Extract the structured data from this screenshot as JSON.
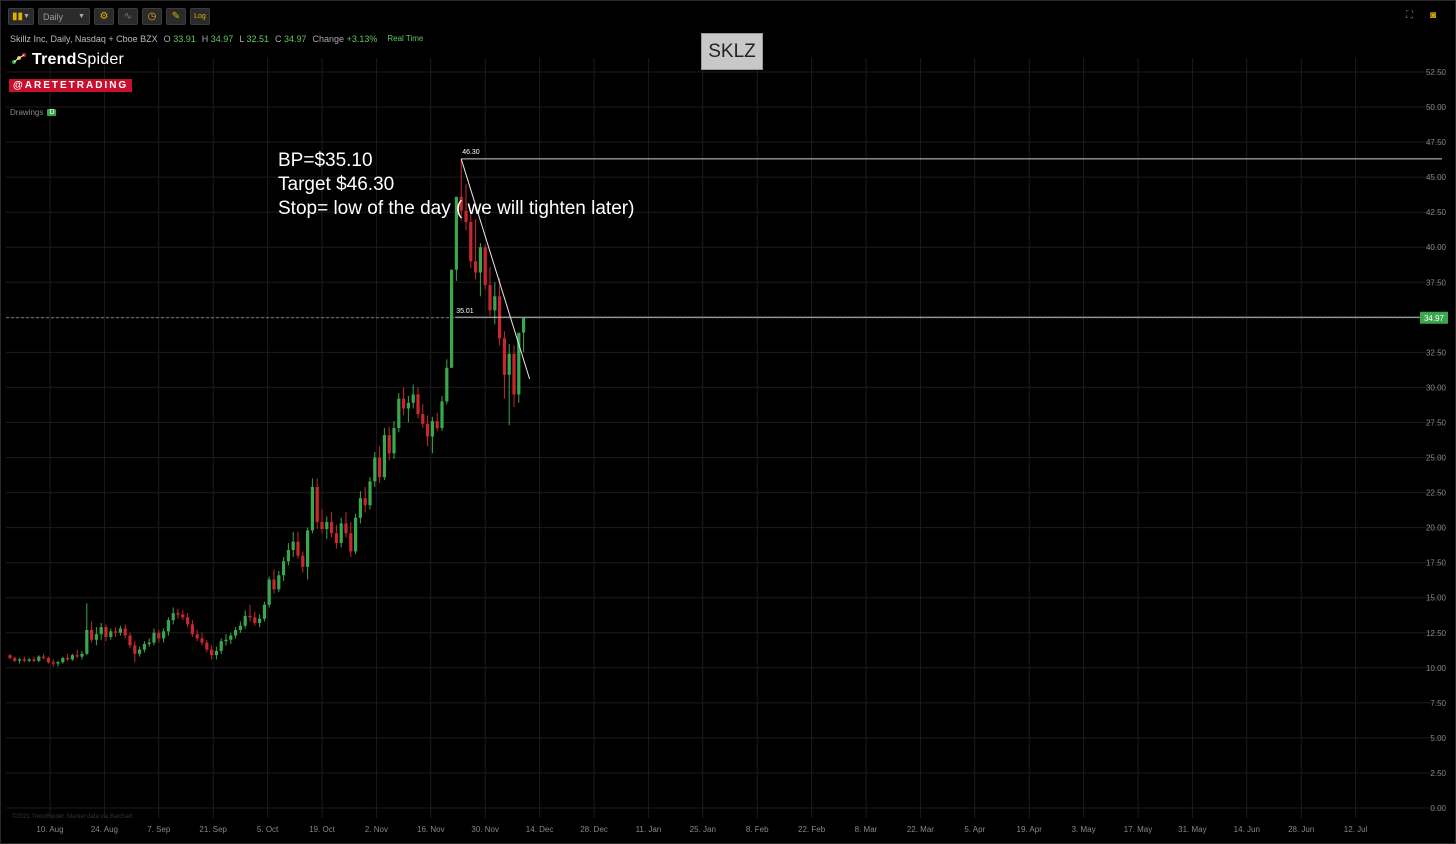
{
  "toolbar": {
    "interval": "Daily",
    "log_label": "Log"
  },
  "header": {
    "title": "Skillz Inc, Daily, Nasdaq + Cboe BZX",
    "open_label": "O",
    "open": "33.91",
    "high_label": "H",
    "high": "34.97",
    "low_label": "L",
    "low": "32.51",
    "close_label": "C",
    "close": "34.97",
    "change_label": "Change",
    "change": "+3.13%",
    "realtime": "Real Time"
  },
  "brand": {
    "name_bold": "Trend",
    "name_light": "Spider",
    "handle": "@ARETETRADING"
  },
  "drawings": {
    "label": "Drawings",
    "badge": "D"
  },
  "ticker": "SKLZ",
  "note": {
    "line1": "BP=$35.10",
    "line2": "Target $46.30",
    "line3": "Stop= low of the day ( we will tighten later)"
  },
  "watermark": "©2021 TrendSpider. Market data via Barchart",
  "colors": {
    "up": "#3aa84a",
    "down": "#c8282d",
    "grid": "#1c1c1c",
    "text": "#888888",
    "price_tag": "#3aa84a"
  },
  "chart_data": {
    "type": "candlestick",
    "title": "SKLZ",
    "y_axis": {
      "min": 0,
      "max": 52.5,
      "step": 2.5,
      "position": "right"
    },
    "y_ticks": [
      "0.00",
      "2.50",
      "5.00",
      "7.50",
      "10.00",
      "12.50",
      "15.00",
      "17.50",
      "20.00",
      "22.50",
      "25.00",
      "27.50",
      "30.00",
      "32.50",
      "35.00",
      "37.50",
      "40.00",
      "42.50",
      "45.00",
      "47.50",
      "50.00",
      "52.50"
    ],
    "x_ticks": [
      "10. Aug",
      "24. Aug",
      "7. Sep",
      "21. Sep",
      "5. Oct",
      "19. Oct",
      "2. Nov",
      "16. Nov",
      "30. Nov",
      "14. Dec",
      "28. Dec",
      "11. Jan",
      "25. Jan",
      "8. Feb",
      "22. Feb",
      "8. Mar",
      "22. Mar",
      "5. Apr",
      "19. Apr",
      "3. May",
      "17. May",
      "31. May",
      "14. Jun",
      "28. Jun",
      "12. Jul"
    ],
    "grid": true,
    "candles": [
      [
        10.9,
        11.0,
        10.6,
        10.7
      ],
      [
        10.7,
        10.8,
        10.4,
        10.5
      ],
      [
        10.5,
        10.7,
        10.3,
        10.6
      ],
      [
        10.6,
        10.8,
        10.4,
        10.5
      ],
      [
        10.5,
        10.7,
        10.4,
        10.6
      ],
      [
        10.6,
        10.8,
        10.4,
        10.5
      ],
      [
        10.5,
        10.9,
        10.4,
        10.8
      ],
      [
        10.8,
        11.0,
        10.6,
        10.7
      ],
      [
        10.7,
        10.8,
        10.3,
        10.4
      ],
      [
        10.4,
        10.6,
        10.1,
        10.3
      ],
      [
        10.3,
        10.5,
        10.1,
        10.4
      ],
      [
        10.4,
        10.8,
        10.3,
        10.7
      ],
      [
        10.7,
        11.0,
        10.5,
        10.6
      ],
      [
        10.6,
        11.0,
        10.5,
        10.9
      ],
      [
        10.9,
        11.3,
        10.7,
        10.8
      ],
      [
        10.8,
        11.2,
        10.6,
        11.0
      ],
      [
        11.0,
        14.6,
        10.9,
        12.7
      ],
      [
        12.7,
        13.3,
        11.8,
        12.0
      ],
      [
        12.0,
        12.9,
        11.6,
        12.4
      ],
      [
        12.4,
        13.2,
        12.0,
        12.9
      ],
      [
        12.9,
        13.1,
        11.9,
        12.2
      ],
      [
        12.2,
        12.8,
        12.0,
        12.6
      ],
      [
        12.6,
        12.9,
        12.2,
        12.5
      ],
      [
        12.5,
        13.0,
        12.3,
        12.8
      ],
      [
        12.8,
        13.1,
        12.1,
        12.3
      ],
      [
        12.3,
        12.5,
        11.4,
        11.6
      ],
      [
        11.6,
        11.9,
        10.4,
        11.0
      ],
      [
        11.0,
        11.5,
        10.8,
        11.3
      ],
      [
        11.3,
        11.9,
        11.1,
        11.7
      ],
      [
        11.7,
        12.1,
        11.5,
        11.8
      ],
      [
        11.8,
        12.8,
        11.6,
        12.5
      ],
      [
        12.5,
        12.7,
        11.8,
        12.1
      ],
      [
        12.1,
        12.8,
        11.8,
        12.6
      ],
      [
        12.6,
        13.6,
        12.3,
        13.4
      ],
      [
        13.4,
        14.3,
        13.1,
        13.9
      ],
      [
        13.9,
        14.2,
        13.5,
        13.8
      ],
      [
        13.8,
        14.1,
        13.4,
        13.6
      ],
      [
        13.6,
        13.9,
        12.9,
        13.1
      ],
      [
        13.1,
        13.4,
        12.2,
        12.4
      ],
      [
        12.4,
        12.7,
        11.9,
        12.1
      ],
      [
        12.1,
        12.5,
        11.6,
        11.8
      ],
      [
        11.8,
        12.0,
        11.1,
        11.3
      ],
      [
        11.3,
        11.6,
        10.6,
        10.9
      ],
      [
        10.9,
        11.5,
        10.6,
        11.2
      ],
      [
        11.2,
        12.1,
        11.0,
        11.9
      ],
      [
        11.9,
        12.4,
        11.6,
        12.0
      ],
      [
        12.0,
        12.5,
        11.7,
        12.3
      ],
      [
        12.3,
        12.9,
        12.1,
        12.7
      ],
      [
        12.7,
        13.3,
        12.5,
        13.0
      ],
      [
        13.0,
        14.1,
        12.8,
        13.7
      ],
      [
        13.7,
        14.5,
        13.3,
        13.6
      ],
      [
        13.6,
        14.0,
        13.0,
        13.2
      ],
      [
        13.2,
        13.8,
        12.9,
        13.5
      ],
      [
        13.5,
        14.7,
        13.3,
        14.5
      ],
      [
        14.5,
        16.5,
        14.3,
        16.3
      ],
      [
        16.3,
        17.0,
        15.3,
        15.6
      ],
      [
        15.6,
        16.9,
        15.4,
        16.6
      ],
      [
        16.6,
        17.9,
        16.2,
        17.6
      ],
      [
        17.6,
        18.9,
        17.3,
        18.4
      ],
      [
        18.4,
        19.7,
        17.9,
        19.0
      ],
      [
        19.0,
        19.7,
        17.8,
        18.0
      ],
      [
        18.0,
        18.3,
        16.8,
        17.2
      ],
      [
        17.2,
        20.0,
        16.3,
        19.8
      ],
      [
        19.8,
        23.5,
        19.6,
        22.9
      ],
      [
        22.9,
        23.5,
        19.9,
        20.4
      ],
      [
        20.4,
        21.3,
        19.6,
        19.9
      ],
      [
        19.9,
        20.8,
        19.2,
        20.4
      ],
      [
        20.4,
        21.1,
        19.3,
        19.6
      ],
      [
        19.6,
        20.2,
        18.5,
        18.9
      ],
      [
        18.9,
        20.7,
        18.6,
        20.3
      ],
      [
        20.3,
        21.1,
        19.3,
        19.6
      ],
      [
        19.6,
        20.4,
        17.9,
        18.3
      ],
      [
        18.3,
        21.0,
        18.1,
        20.7
      ],
      [
        20.7,
        22.6,
        20.3,
        22.1
      ],
      [
        22.1,
        22.9,
        21.1,
        21.6
      ],
      [
        21.6,
        23.6,
        21.3,
        23.3
      ],
      [
        23.3,
        25.4,
        22.9,
        25.0
      ],
      [
        25.0,
        25.8,
        23.2,
        23.6
      ],
      [
        23.6,
        27.1,
        23.4,
        26.6
      ],
      [
        26.6,
        27.2,
        24.8,
        25.3
      ],
      [
        25.3,
        27.6,
        24.9,
        27.1
      ],
      [
        27.1,
        29.6,
        26.8,
        29.2
      ],
      [
        29.2,
        30.0,
        28.0,
        28.5
      ],
      [
        28.5,
        29.4,
        27.5,
        28.9
      ],
      [
        28.9,
        30.2,
        28.5,
        29.5
      ],
      [
        29.5,
        30.0,
        27.8,
        28.1
      ],
      [
        28.1,
        28.8,
        27.1,
        27.4
      ],
      [
        27.4,
        28.0,
        25.8,
        26.5
      ],
      [
        26.5,
        27.9,
        25.3,
        27.6
      ],
      [
        27.6,
        28.2,
        26.9,
        27.1
      ],
      [
        27.1,
        29.4,
        26.9,
        29.0
      ],
      [
        29.0,
        32.0,
        28.8,
        31.4
      ],
      [
        31.4,
        36.6,
        34.9,
        38.4
      ],
      [
        38.4,
        40.0,
        37.6,
        43.6
      ],
      [
        43.6,
        46.3,
        41.9,
        42.6
      ],
      [
        42.6,
        44.5,
        41.2,
        41.8
      ],
      [
        41.8,
        42.6,
        38.5,
        39.0
      ],
      [
        39.0,
        42.0,
        37.7,
        38.2
      ],
      [
        38.2,
        40.3,
        36.5,
        40.0
      ],
      [
        40.0,
        40.2,
        37.0,
        37.3
      ],
      [
        37.3,
        38.6,
        35.1,
        35.5
      ],
      [
        35.5,
        37.5,
        34.5,
        36.5
      ],
      [
        36.5,
        37.8,
        33.0,
        33.5
      ],
      [
        33.5,
        34.0,
        29.2,
        30.9
      ],
      [
        30.9,
        33.1,
        27.3,
        32.4
      ],
      [
        32.4,
        33.0,
        28.6,
        29.5
      ],
      [
        29.5,
        32.6,
        28.9,
        33.9
      ],
      [
        33.91,
        34.97,
        32.51,
        34.97
      ]
    ],
    "levels": [
      {
        "label": "46.30",
        "value": 46.3
      },
      {
        "label": "35.01",
        "value": 35.01
      }
    ],
    "last_price": {
      "label": "34.97",
      "value": 34.97
    },
    "trendline": {
      "from_value": 46.3,
      "to_value": 30.6
    }
  }
}
